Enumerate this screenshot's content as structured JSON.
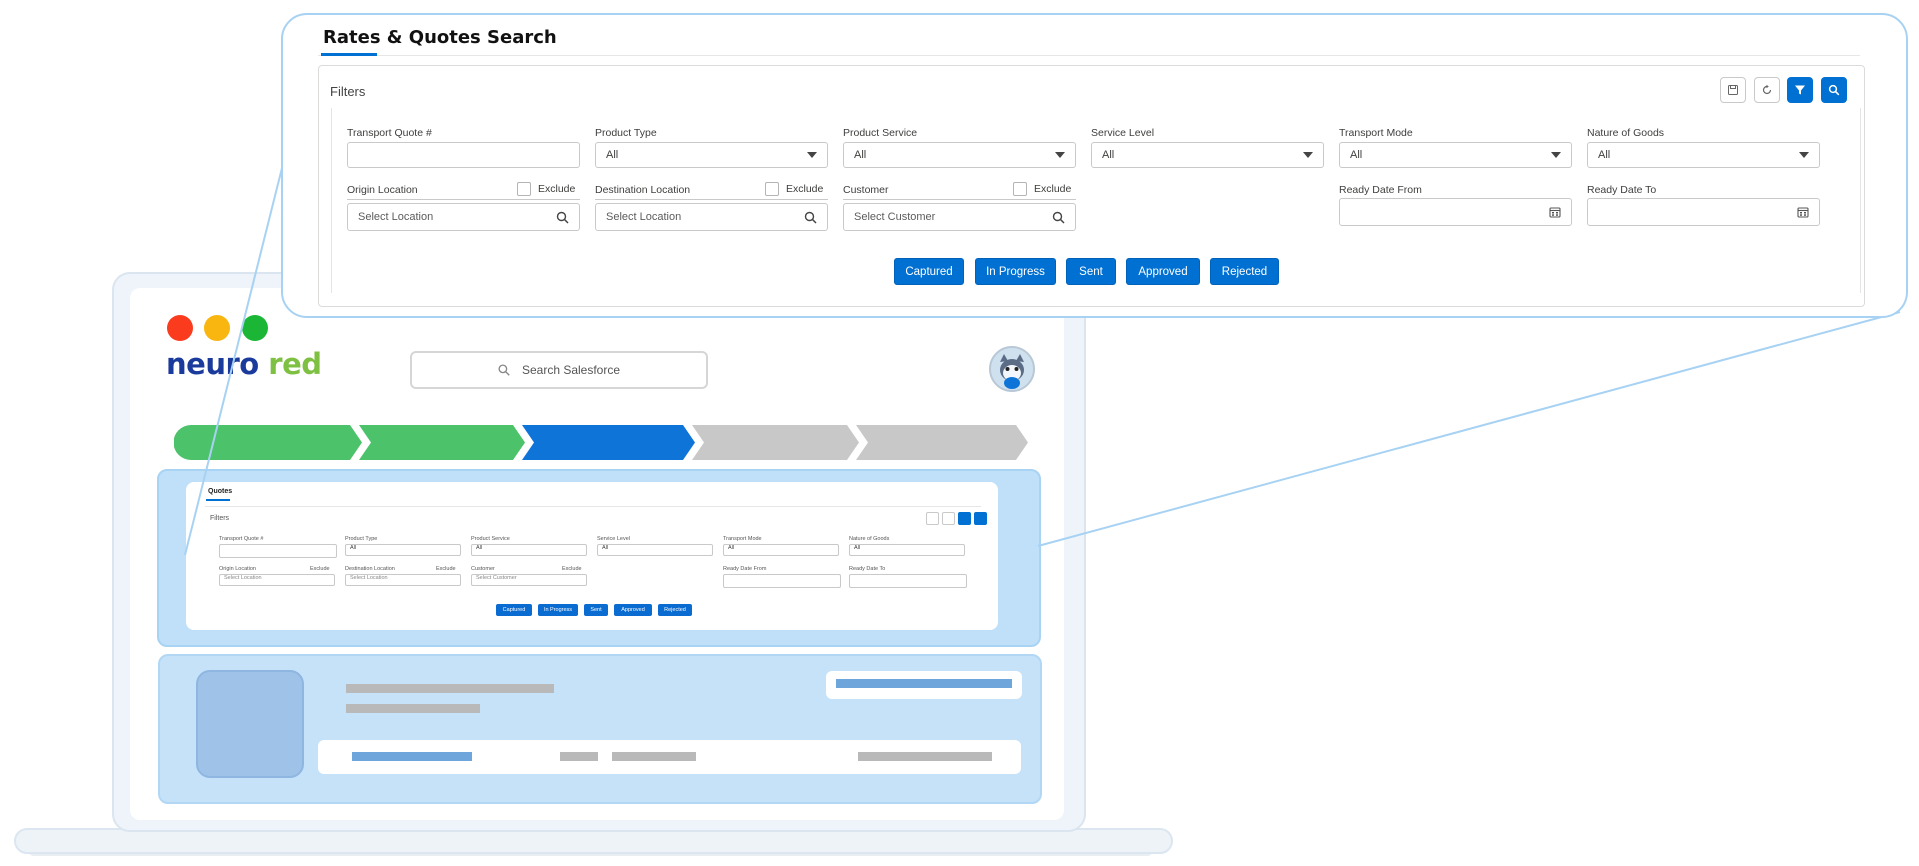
{
  "header": {
    "title": "Rates & Quotes Search"
  },
  "filters": {
    "label": "Filters",
    "toolbar": {
      "save_icon": "save-icon",
      "refresh_icon": "refresh-icon",
      "filter_icon": "funnel-icon",
      "search_icon": "search-icon"
    },
    "fields": {
      "transport_quote": {
        "label": "Transport Quote #",
        "value": ""
      },
      "product_type": {
        "label": "Product Type",
        "value": "All"
      },
      "product_service": {
        "label": "Product Service",
        "value": "All"
      },
      "service_level": {
        "label": "Service Level",
        "value": "All"
      },
      "transport_mode": {
        "label": "Transport Mode",
        "value": "All"
      },
      "nature_of_goods": {
        "label": "Nature of Goods",
        "value": "All"
      },
      "origin_location": {
        "label": "Origin Location",
        "placeholder": "Select Location",
        "exclude_label": "Exclude"
      },
      "destination_location": {
        "label": "Destination Location",
        "placeholder": "Select Location",
        "exclude_label": "Exclude"
      },
      "customer": {
        "label": "Customer",
        "placeholder": "Select Customer",
        "exclude_label": "Exclude"
      },
      "ready_date_from": {
        "label": "Ready Date From",
        "value": ""
      },
      "ready_date_to": {
        "label": "Ready Date To",
        "value": ""
      }
    },
    "status_buttons": [
      "Captured",
      "In Progress",
      "Sent",
      "Approved",
      "Rejected"
    ]
  },
  "mockup": {
    "brand_part1": "neuro",
    "brand_part2": " red",
    "search_placeholder": "Search Salesforce",
    "mini_tab": "Quotes",
    "mini_filters_label": "Filters",
    "mini_labels": {
      "transport_quote": "Transport Quote #",
      "product_type": "Product Type",
      "product_service": "Product Service",
      "service_level": "Service Level",
      "transport_mode": "Transport Mode",
      "nature_of_goods": "Nature of Goods",
      "origin_location": "Origin Location",
      "destination_location": "Destination Location",
      "customer": "Customer",
      "ready_date_from": "Ready Date From",
      "ready_date_to": "Ready Date To",
      "exclude": "Exclude",
      "select_location": "Select Location",
      "select_customer": "Select Customer",
      "all": "All"
    },
    "progress_steps": [
      {
        "color": "#4cc26a"
      },
      {
        "color": "#4cc26a"
      },
      {
        "color": "#0f74d8"
      },
      {
        "color": "#c8c8c8"
      },
      {
        "color": "#c8c8c8"
      }
    ]
  },
  "colors": {
    "accent": "#0070d2",
    "panel_blue": "#bfe0f8"
  }
}
